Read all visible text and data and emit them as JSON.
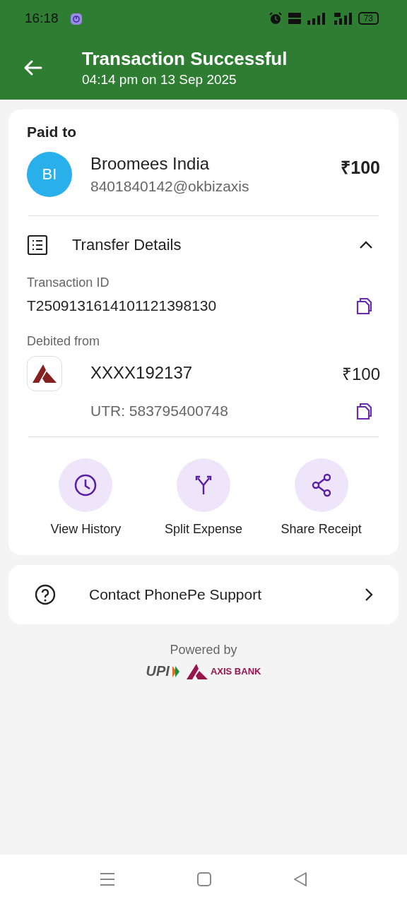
{
  "status_bar": {
    "time": "16:18",
    "battery": "73"
  },
  "header": {
    "title": "Transaction Successful",
    "subtitle": "04:14 pm on 13 Sep 2025"
  },
  "paid_to": {
    "heading": "Paid to",
    "avatar": "BI",
    "name": "Broomees India",
    "upi_id": "8401840142@okbizaxis",
    "amount": "₹100"
  },
  "transfer_details": {
    "title": "Transfer Details",
    "expanded": true,
    "transaction_id_label": "Transaction ID",
    "transaction_id": "T2509131614101121398130",
    "debited_label": "Debited from",
    "account": "XXXX192137",
    "amount": "₹100",
    "utr": "UTR: 583795400748"
  },
  "actions": [
    {
      "kind": "history",
      "label": "View History"
    },
    {
      "kind": "split",
      "label": "Split Expense"
    },
    {
      "kind": "share",
      "label": "Share Receipt"
    }
  ],
  "support": {
    "label": "Contact PhonePe Support"
  },
  "footer": {
    "powered_by": "Powered by",
    "upi_logo": "UPI",
    "bank_logo": "AXIS BANK"
  }
}
